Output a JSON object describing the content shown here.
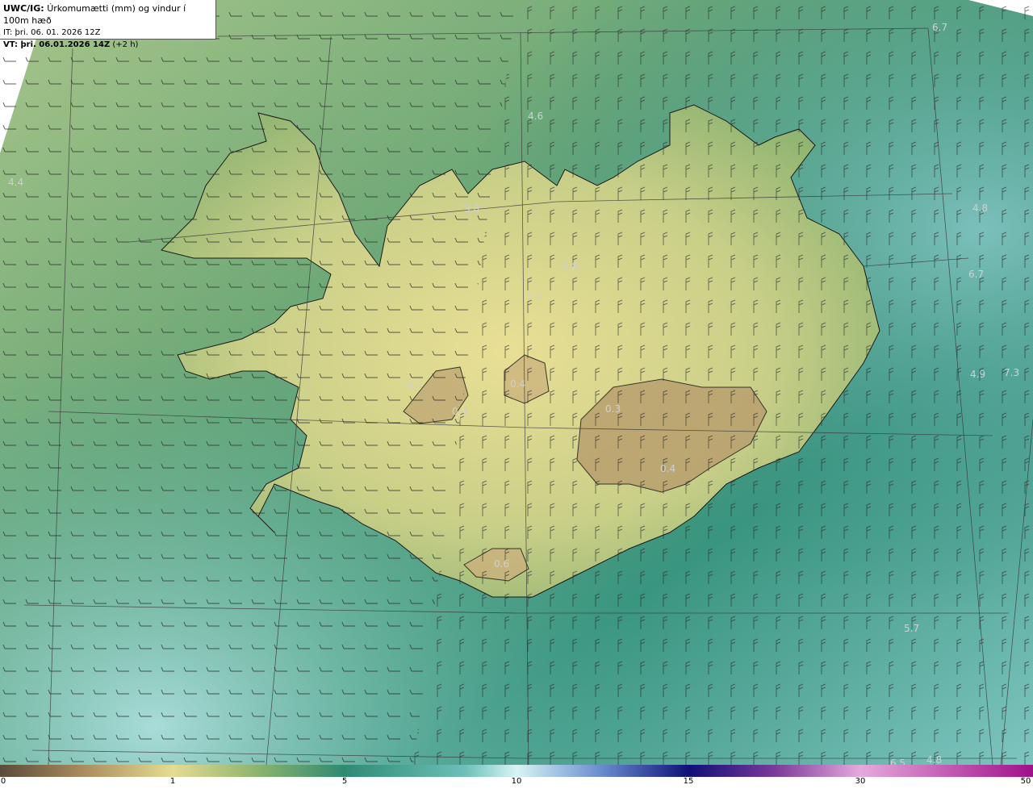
{
  "header": {
    "model_label": "UWC/IG:",
    "title": "Úrkomumætti (mm) og vindur í 100m hæð",
    "it_label": "IT:",
    "it_value": "þri. 06. 01. 2026 12Z",
    "vt_label": "VT: þri. 06.01.2026 14Z",
    "vt_lead": "(+2 h)"
  },
  "colorbar": {
    "ticks": [
      {
        "label": "0",
        "value": 0
      },
      {
        "label": "1",
        "value": 1
      },
      {
        "label": "5",
        "value": 5
      },
      {
        "label": "10",
        "value": 10
      },
      {
        "label": "15",
        "value": 15
      },
      {
        "label": "30",
        "value": 30
      },
      {
        "label": "50",
        "value": 50
      }
    ]
  },
  "value_labels": [
    "6.7",
    "4.6",
    "4.4",
    "3.8",
    "4.8",
    "6.7",
    "0.8",
    "1.0",
    "0.4",
    "0.3",
    "4.9",
    "7.3",
    "0.4",
    "0.4",
    "0.4",
    "0.6",
    "5.7",
    "6.5",
    "4.8"
  ],
  "colors": {
    "sea_deep": "#2f8f7a",
    "sea_light": "#7fc4bf",
    "land_green": "#7daa6a",
    "land_yellow": "#e8df95",
    "glacier_tan": "#b49c6e",
    "outline": "#1a1a1a",
    "grid": "#3a3a3a"
  }
}
